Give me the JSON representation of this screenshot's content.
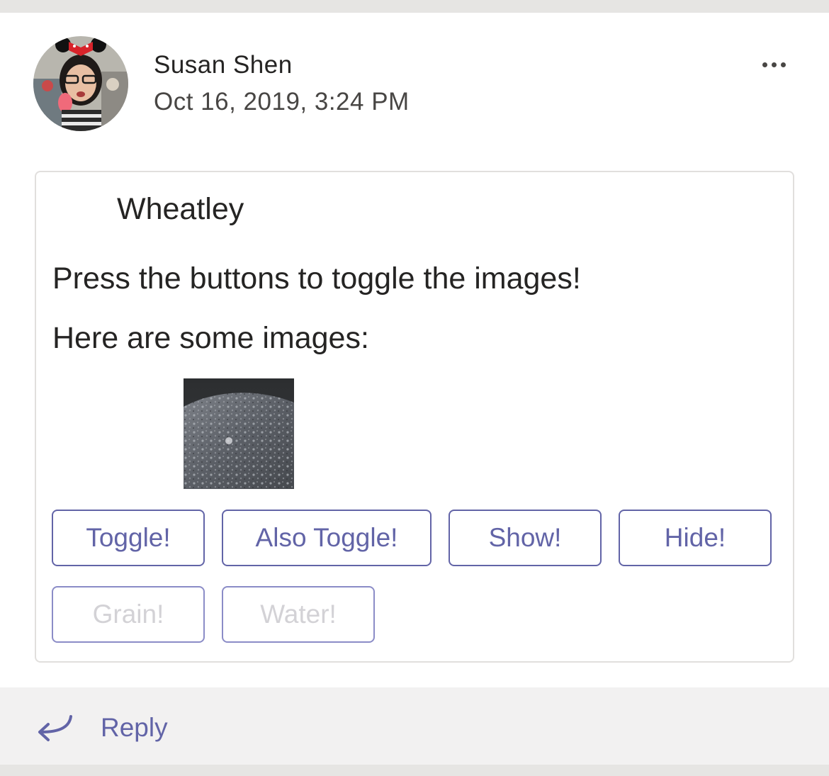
{
  "post": {
    "author": "Susan Shen",
    "timestamp": "Oct 16, 2019, 3:24 PM",
    "avatar_icon": "user-avatar-photo",
    "more_icon": "more-options-icon"
  },
  "card": {
    "title": "Wheatley",
    "text1": "Press the buttons to toggle the images!",
    "text2": "Here are some images:",
    "image_icon": "grain-texture-photo",
    "buttons": [
      {
        "label": "Toggle!",
        "enabled": true
      },
      {
        "label": "Also Toggle!",
        "enabled": true
      },
      {
        "label": "Show!",
        "enabled": true
      },
      {
        "label": "Hide!",
        "enabled": true
      },
      {
        "label": "Grain!",
        "enabled": false
      },
      {
        "label": "Water!",
        "enabled": false
      }
    ]
  },
  "reply": {
    "label": "Reply",
    "icon": "reply-arrow-icon"
  },
  "colors": {
    "accent": "#6264a7",
    "text": "#252423",
    "border": "#e1dfdd",
    "footer_bg": "#f2f1f1",
    "page_bg": "#e6e5e3"
  }
}
